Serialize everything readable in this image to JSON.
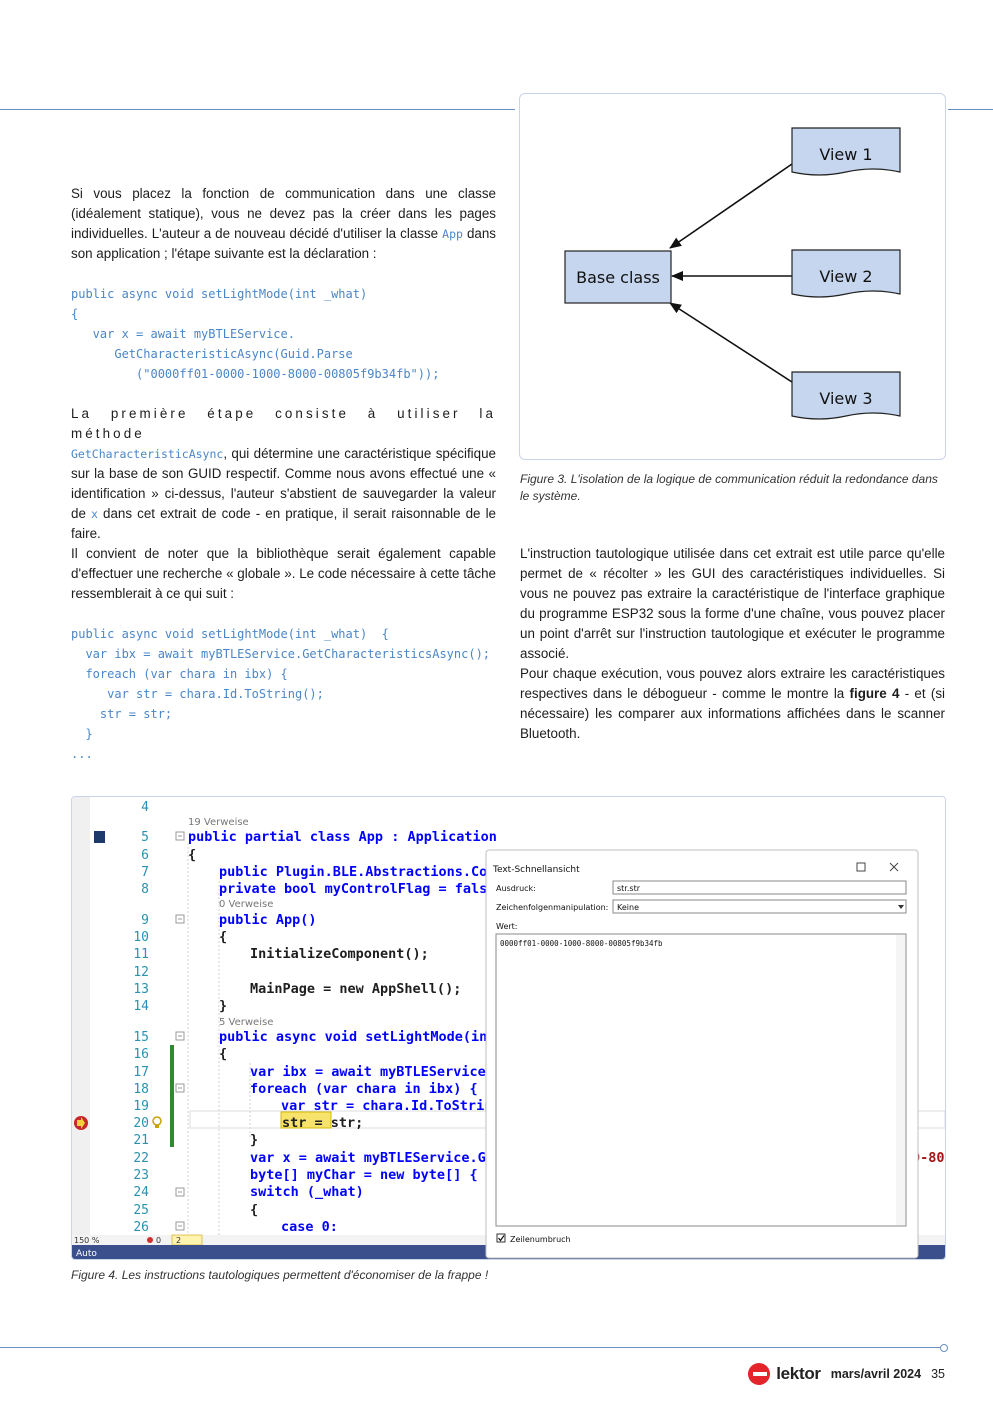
{
  "left_column": {
    "para1": "Si vous placez la fonction de communication dans une classe (idéalement statique), vous ne devez pas la créer dans les pages individuelles. L'auteur a de nouveau décidé d'utiliser la classe ",
    "para1_code": "App",
    "para1_end": " dans son application ; l'étape suivante est la déclaration :",
    "code1": [
      "public async void setLightMode(int _what)",
      "{",
      "   var x = await myBTLEService.",
      "      GetCharacteristicAsync(Guid.Parse",
      "         (\"0000ff01-0000-1000-8000-00805f9b34fb\"));"
    ],
    "para2_start": "La première étape consiste à utiliser la méthode",
    "para2_code": "GetCharacteristicAsync",
    "para2_mid": ", qui détermine une caractéristique spécifique sur la base de son GUID respectif. Comme nous avons effectué une « identification » ci-dessus, l'auteur s'abstient de sauvegarder la valeur de ",
    "para2_code2": "x",
    "para2_end": " dans cet extrait de code - en pratique, il serait raisonnable de le faire.",
    "para3": "Il convient de noter que la bibliothèque serait également capable d'effectuer une recherche « globale ». Le code nécessaire à cette tâche ressemblerait à ce qui suit :",
    "code2": [
      "public async void setLightMode(int _what)  {",
      "  var ibx = await myBTLEService.GetCharacteristicsAsync();",
      "  foreach (var chara in ibx) {",
      "     var str = chara.Id.ToString();",
      "    str = str;",
      "  }",
      "..."
    ]
  },
  "figure3": {
    "nodes": {
      "base": "Base class",
      "view1": "View 1",
      "view2": "View 2",
      "view3": "View 3"
    },
    "caption": "Figure 3. L'isolation de la logique de communication réduit la redondance dans le système.",
    "colors": {
      "box_fill": "#c6d6ee",
      "box_stroke": "#222222"
    }
  },
  "right_column": {
    "para1": "L'instruction tautologique utilisée dans cet extrait est utile parce qu'elle permet de « récolter » les GUI des caractéristiques individuelles. Si vous ne pouvez pas extraire la caractéristique de l'interface graphique du programme ESP32 sous la forme d'une chaîne, vous pouvez placer un point d'arrêt sur l'instruction tautologique et exécuter le programme associé.",
    "para2_start": "Pour chaque exécution, vous pouvez alors extraire les caractéristiques respectives dans le débogueur - comme le montre la ",
    "para2_bold": "figure 4",
    "para2_end": " - et (si nécessaire) les comparer aux informations affichées dans le scanner Bluetooth."
  },
  "figure4": {
    "lines": [
      "4",
      "5",
      "6",
      "7",
      "8",
      "9",
      "10",
      "11",
      "12",
      "13",
      "14",
      "15",
      "16",
      "17",
      "18",
      "19",
      "20",
      "21",
      "22",
      "23",
      "24",
      "25",
      "26"
    ],
    "ref19": "19 Verweise",
    "ref0": "0 Verweise",
    "ref5": "5 Verweise",
    "code": {
      "l5": "public partial class App : Application",
      "l6": "{",
      "l7": "public Plugin.BLE.Abstractions.Cont",
      "l8": "private bool myControlFlag = false;",
      "l9": "public App()",
      "l10": "{",
      "l11": "InitializeComponent();",
      "l13": "MainPage = new AppShell();",
      "l14": "}",
      "l15": "public async void setLightMode(int",
      "l16": "{",
      "l17": "var ibx = await myBTLEService.G",
      "l18": "foreach (var chara in ibx) {",
      "l19": "var str = chara.Id.ToString",
      "l20": "str = str;",
      "l21": "}",
      "l22": "var x = await myBTLEService.Get",
      "l23": "byte[] myChar = new byte[] { (b",
      "l24": "switch (_what)",
      "l25": "{",
      "l26": "case 0:",
      "overflow22": "0-80"
    },
    "statusbar": {
      "zoom": "150 %",
      "errors": "0",
      "warnings": "2",
      "mode": "Auto"
    },
    "dialog": {
      "title": "Text-Schnellansicht",
      "expr_label": "Ausdruck:",
      "expr_value": "str.str",
      "manip_label": "Zeichenfolgenmanipulation:",
      "manip_value": "Keine",
      "value_label": "Wert:",
      "value": "0000ff01-0000-1000-8000-00805f9b34fb",
      "wrap_label": "Zeilenumbruch"
    },
    "caption": "Figure 4. Les instructions tautologiques permettent d'économiser de la frappe !"
  },
  "footer": {
    "brand": "lektor",
    "issue": "mars/avril 2024",
    "page": "35"
  }
}
